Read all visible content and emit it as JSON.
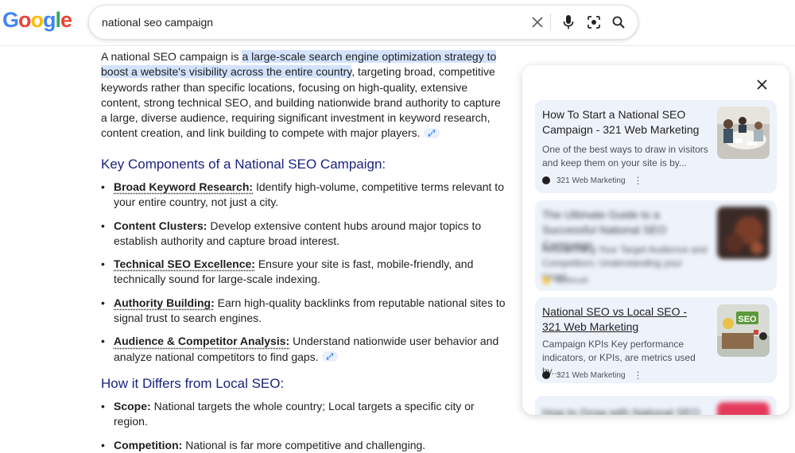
{
  "logo": {
    "text": "Google"
  },
  "search": {
    "query": "national seo campaign"
  },
  "answer": {
    "intro_before": "A national SEO campaign is ",
    "intro_highlight": "a large-scale search engine optimization strategy to boost a website's visibility across the entire country",
    "intro_after": ", targeting broad, competitive keywords rather than specific locations, focusing on high-quality, extensive content, strong technical SEO, and building nationwide brand authority to capture a large, diverse audience, requiring significant investment in keyword research, content creation, and link building to compete with major players.",
    "section1_heading": "Key Components of a National SEO Campaign:",
    "components": [
      {
        "term": "Broad Keyword Research:",
        "text": " Identify high-volume, competitive terms relevant to your entire country, not just a city."
      },
      {
        "term": "Content Clusters:",
        "text": " Develop extensive content hubs around major topics to establish authority and capture broad interest."
      },
      {
        "term": "Technical SEO Excellence:",
        "text": " Ensure your site is fast, mobile-friendly, and technically sound for large-scale indexing."
      },
      {
        "term": "Authority Building:",
        "text": " Earn high-quality backlinks from reputable national sites to signal trust to search engines."
      },
      {
        "term": "Audience & Competitor Analysis:",
        "text": " Understand nationwide user behavior and analyze national competitors to find gaps."
      }
    ],
    "section2_heading": "How it Differs from Local SEO:",
    "differences": [
      {
        "term": "Scope:",
        "text": " National targets the whole country; Local targets a specific city or region."
      },
      {
        "term": "Competition:",
        "text": " National is far more competitive and challenging."
      }
    ]
  },
  "sources": [
    {
      "title": "How To Start a National SEO Campaign - 321 Web Marketing",
      "snippet": "One of the best ways to draw in visitors and keep them on your site is by...",
      "site": "321 Web Marketing"
    },
    {
      "title": "The Ultimate Guide to a Successful National SEO Campaign",
      "snippet": "Researching Your Target Audience and Competitors: Understanding your target...",
      "site": "Semrush"
    },
    {
      "title": "National SEO vs Local SEO - 321 Web Marketing",
      "snippet": "Campaign KPIs Key performance indicators, or KPIs, are metrics used by...",
      "site": "321 Web Marketing",
      "thumb_text": "SEO"
    },
    {
      "title": "How to Grow with National SEO »"
    }
  ],
  "colors": {
    "heading": "#1a237e",
    "highlight": "#d3e3fd",
    "card_bg": "#eef3fb"
  }
}
